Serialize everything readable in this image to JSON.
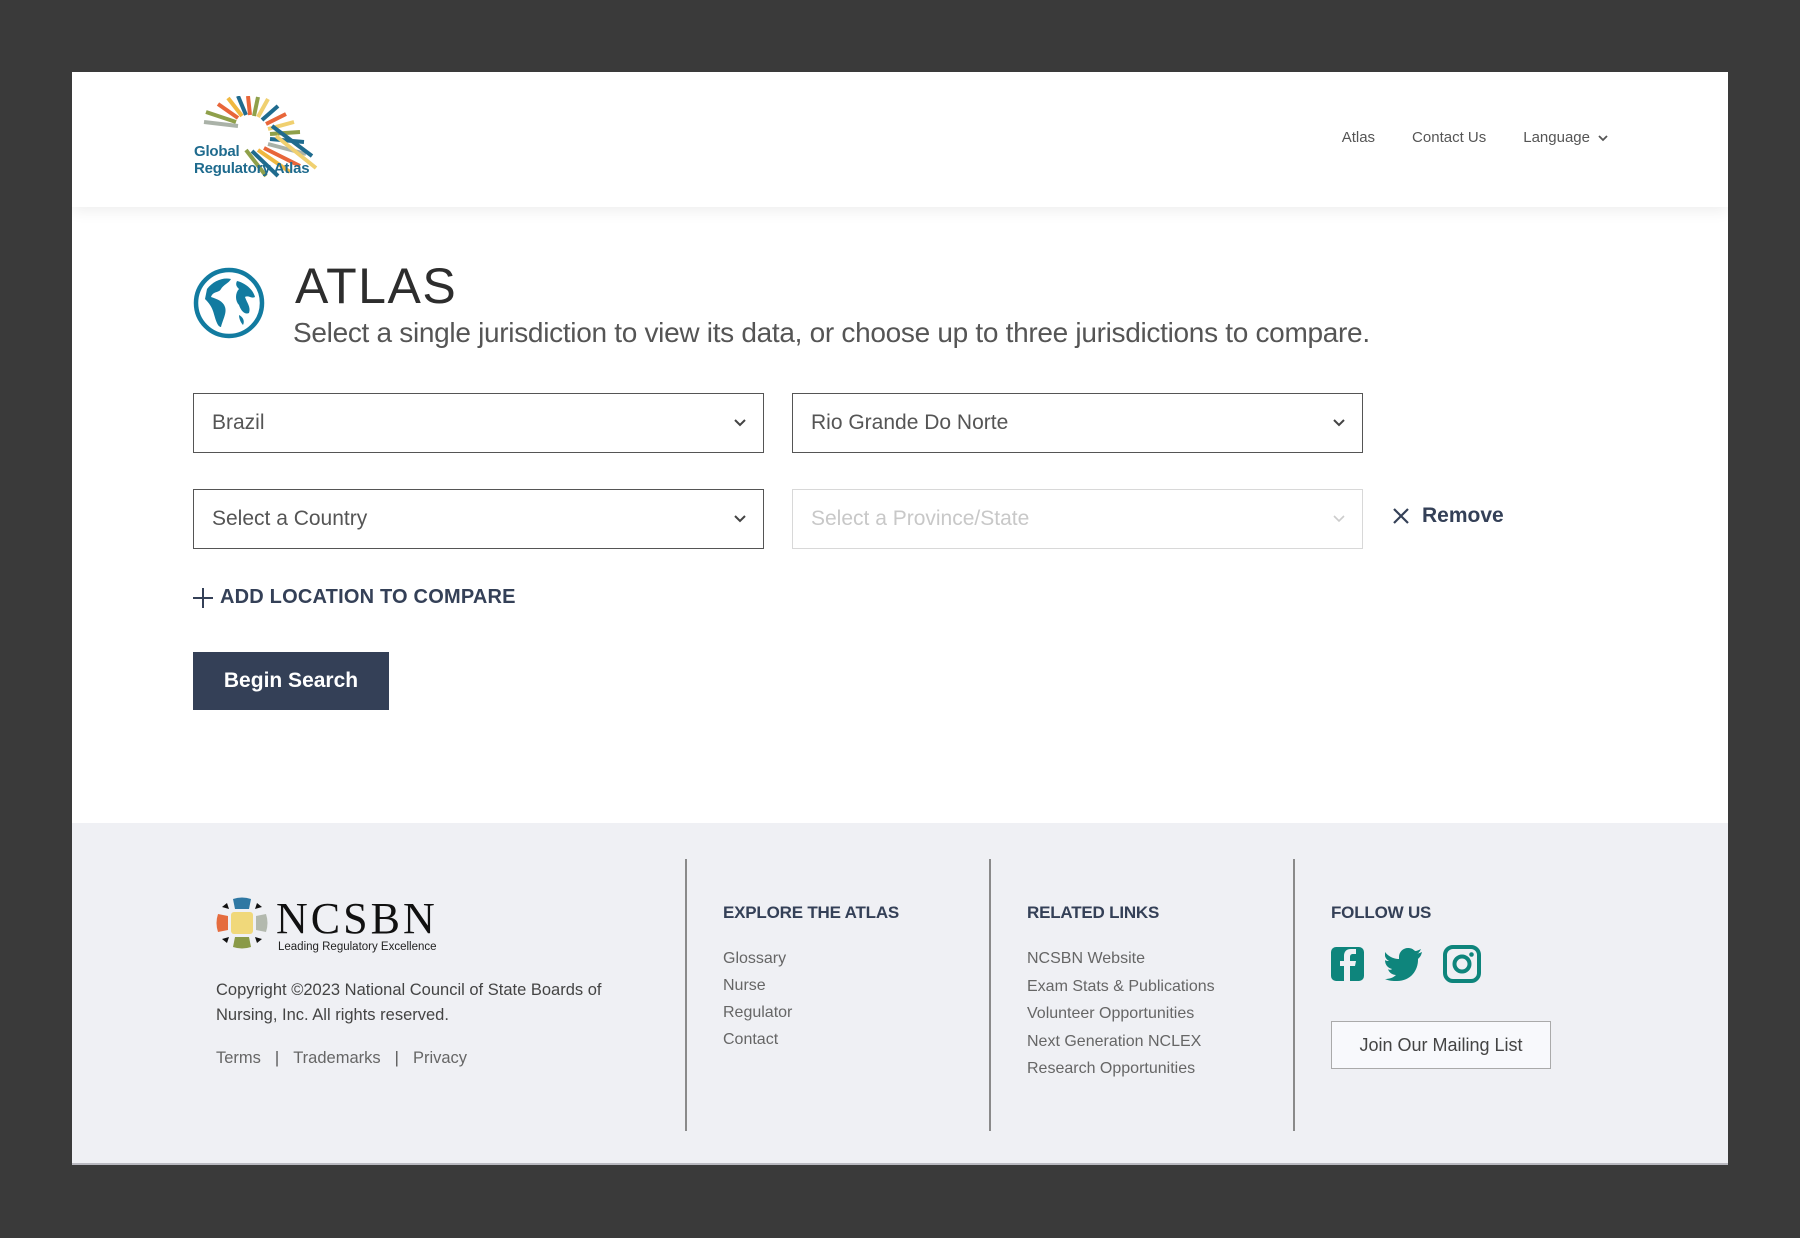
{
  "header": {
    "logo_line1": "Global",
    "logo_line2": "Regulatory Atlas",
    "nav": [
      {
        "label": "Atlas"
      },
      {
        "label": "Contact Us"
      },
      {
        "label": "Language"
      }
    ]
  },
  "main": {
    "title": "ATLAS",
    "subtitle": "Select a single jurisdiction to view its data, or choose up to three jurisdictions to compare.",
    "locations": [
      {
        "country": "Brazil",
        "province": "Rio Grande Do Norte",
        "province_disabled": false
      },
      {
        "country_placeholder": "Select a Country",
        "province_placeholder": "Select a Province/State",
        "province_disabled": true
      }
    ],
    "remove_label": "Remove",
    "add_label": "ADD LOCATION TO COMPARE",
    "begin_label": "Begin Search"
  },
  "footer": {
    "org_name": "NCSBN",
    "org_tagline": "Leading Regulatory Excellence",
    "copyright": "Copyright ©2023 National Council of State Boards of Nursing, Inc. All rights reserved.",
    "legal_links": [
      "Terms",
      "Trademarks",
      "Privacy"
    ],
    "explore": {
      "heading": "EXPLORE THE ATLAS",
      "links": [
        "Glossary",
        "Nurse",
        "Regulator",
        "Contact"
      ]
    },
    "related": {
      "heading": "RELATED LINKS",
      "links": [
        "NCSBN Website",
        "Exam Stats & Publications",
        "Volunteer Opportunities",
        "Next Generation NCLEX",
        "Research Opportunities"
      ]
    },
    "follow": {
      "heading": "FOLLOW US",
      "icons": [
        "facebook-icon",
        "twitter-icon",
        "instagram-icon"
      ],
      "mailing_label": "Join Our Mailing List"
    }
  },
  "colors": {
    "brand_navy": "#344057",
    "teal": "#0e857c",
    "globe_blue": "#127ba0"
  }
}
